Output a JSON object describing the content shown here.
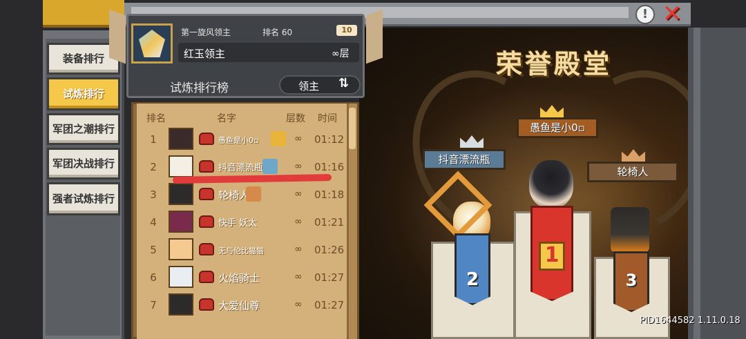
{
  "window": {
    "help_symbol": "!",
    "close_symbol": "✕",
    "build_id": "PID1644582 1.11.0.18"
  },
  "sidebar": {
    "items": [
      {
        "label": "装备排行",
        "active": false
      },
      {
        "label": "试炼排行",
        "active": true
      },
      {
        "label": "军团之潮排行",
        "active": false
      },
      {
        "label": "军团决战排行",
        "active": false
      },
      {
        "label": "强者试炼排行",
        "active": false
      }
    ]
  },
  "player_info": {
    "title": "第一旋风领主",
    "rank_text": "排名 60",
    "tag": "10",
    "name": "红玉领主",
    "floor": "∞层"
  },
  "leaderboard": {
    "heading": "试炼排行榜",
    "filter_value": "领主",
    "swap_icon": "⇅",
    "columns": [
      "排名",
      "名字",
      "层数",
      "时间"
    ],
    "rows": [
      {
        "rank": "1",
        "name": "愚鱼是小0▫",
        "floor": "∞",
        "time": "01:12",
        "avatar_color": "#3a2a2a",
        "badge_color": "#e9b43a"
      },
      {
        "rank": "2",
        "name": "抖音漂流瓶",
        "floor": "∞",
        "time": "01:16",
        "avatar_color": "#f3efe5",
        "badge_color": "#6ea7c8"
      },
      {
        "rank": "3",
        "name": "轮椅人",
        "floor": "∞",
        "time": "01:18",
        "avatar_color": "#2d2b29",
        "badge_color": "#d58a4c"
      },
      {
        "rank": "4",
        "name": "快手 妖太",
        "floor": "∞",
        "time": "01:21",
        "avatar_color": "#7a2a4a",
        "badge_color": ""
      },
      {
        "rank": "5",
        "name": "无与伦比猫猫",
        "floor": "∞",
        "time": "01:26",
        "avatar_color": "#f5c98f",
        "badge_color": ""
      },
      {
        "rank": "6",
        "name": "火焰骑士",
        "floor": "∞",
        "time": "01:27",
        "avatar_color": "#e9eef2",
        "badge_color": ""
      },
      {
        "rank": "7",
        "name": "大爱仙尊",
        "floor": "∞",
        "time": "01:27",
        "avatar_color": "#2d2b29",
        "badge_color": ""
      }
    ]
  },
  "hall_of_fame": {
    "title": "荣誉殿堂",
    "first": {
      "name": "愚鱼是小0▫",
      "place": "1"
    },
    "second": {
      "name": "抖音漂流瓶",
      "place": "2"
    },
    "third": {
      "name": "轮椅人",
      "place": "3"
    }
  },
  "colors": {
    "gold": "#f5c84a",
    "red_annotation": "#e23b3b",
    "list_bg": "#d4b07b",
    "first_banner": "#d9352c",
    "second_banner": "#4f86c3",
    "third_banner": "#a25a2a"
  }
}
